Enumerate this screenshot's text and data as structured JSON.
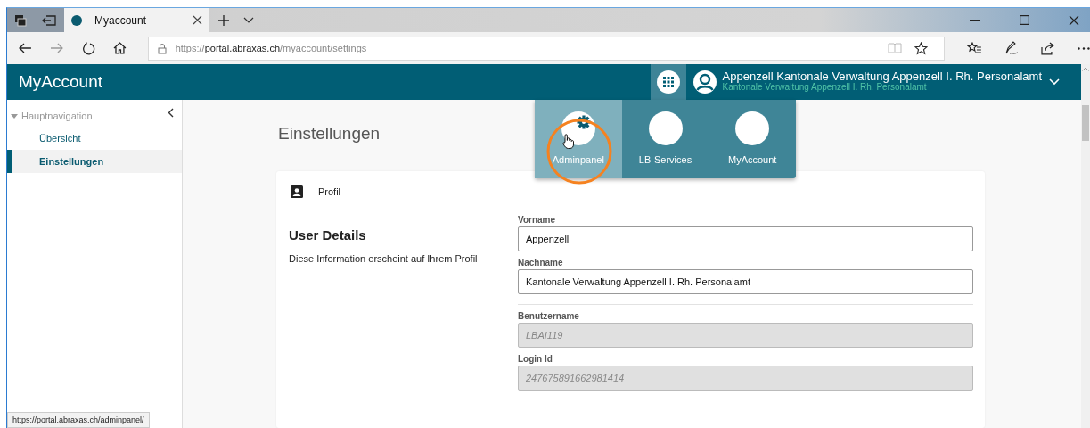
{
  "browser": {
    "tab": {
      "title": "Myaccount",
      "selected": true
    },
    "address": {
      "scheme": "https://",
      "host": "portal.abraxas.ch",
      "path": "/myaccount/settings"
    },
    "status_url": "https://portal.abraxas.ch/adminpanel/"
  },
  "header": {
    "app_title": "MyAccount",
    "user_name": "Appenzell Kantonale Verwaltung Appenzell I. Rh. Personalamt",
    "user_org": "Kantonale Verwaltung Appenzell I. Rh. Personalamt"
  },
  "app_menu": [
    {
      "label": "Adminpanel",
      "selected": true,
      "kind": "gear"
    },
    {
      "label": "LB-Services",
      "selected": false,
      "kind": "blank"
    },
    {
      "label": "MyAccount",
      "selected": false,
      "kind": "blank"
    }
  ],
  "sidebar": {
    "section": "Hauptnavigation",
    "expanded": true,
    "items": [
      {
        "label": "Übersicht",
        "selected": false
      },
      {
        "label": "Einstellungen",
        "selected": true
      }
    ]
  },
  "page_title": "Einstellungen",
  "card": {
    "title": "Profil",
    "heading": "User Details",
    "description": "Diese Information erscheint auf Ihrem Profil",
    "field_groups": [
      {
        "fields": [
          {
            "label": "Vorname",
            "value": "Appenzell",
            "disabled": false
          },
          {
            "label": "Nachname",
            "value": "Kantonale Verwaltung Appenzell I. Rh. Personalamt",
            "disabled": false
          }
        ]
      },
      {
        "fields": [
          {
            "label": "Benutzername",
            "value": "LBAI119",
            "disabled": true
          },
          {
            "label": "Login Id",
            "value": "247675891662981414",
            "disabled": true
          }
        ]
      }
    ]
  }
}
